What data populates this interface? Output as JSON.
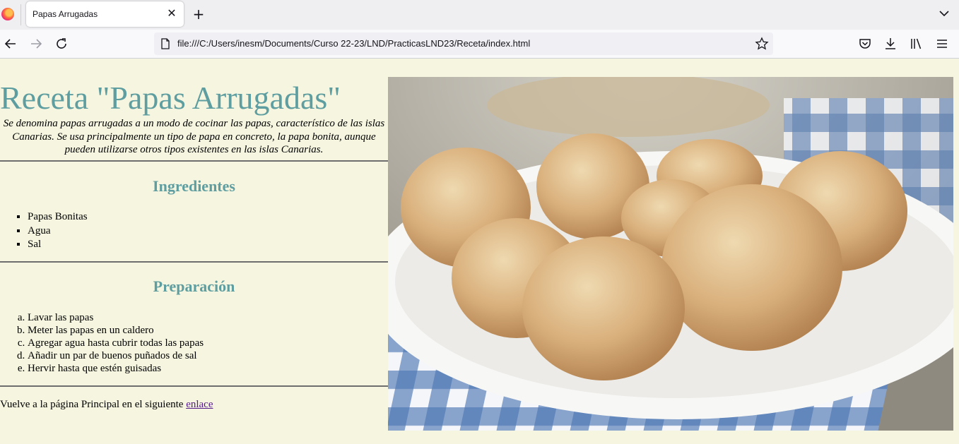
{
  "browser": {
    "tab_title": "Papas Arrugadas",
    "url": "file:///C:/Users/inesm/Documents/Curso 22-23/LND/PracticasLND23/Receta/index.html"
  },
  "page": {
    "title": "Receta \"Papas Arrugadas\"",
    "intro": "Se denomina papas arrugadas a un modo de cocinar las papas, característico de las islas Canarias. Se usa principalmente un tipo de papa en concreto, la papa bonita, aunque pueden utilizarse otros tipos existentes en las islas Canarias.",
    "ingredients_heading": "Ingredientes",
    "ingredients": [
      "Papas Bonitas",
      "Agua",
      "Sal"
    ],
    "preparation_heading": "Preparación",
    "steps": [
      "Lavar las papas",
      "Meter las papas en un caldero",
      "Agregar agua hasta cubrir todas las papas",
      "Añadir un par de buenos puñados de sal",
      "Hervir hasta que estén guisadas"
    ],
    "footer_text": "Vuelve a la página Principal en el siguiente ",
    "footer_link": "enlace"
  },
  "colors": {
    "page_background": "#f5f5e0",
    "heading": "#5f9ea0",
    "link": "#551a8b"
  }
}
